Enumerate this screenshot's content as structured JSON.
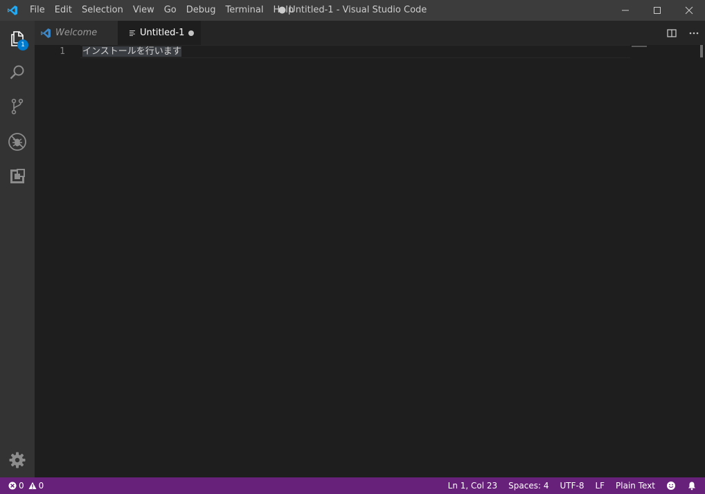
{
  "window": {
    "title": "● Untitled-1 - Visual Studio Code"
  },
  "menu": [
    "File",
    "Edit",
    "Selection",
    "View",
    "Go",
    "Debug",
    "Terminal",
    "Help"
  ],
  "activity_bar": {
    "items": [
      "explorer-icon",
      "search-icon",
      "source-control-icon",
      "debug-icon",
      "extensions-icon"
    ],
    "explorer_badge": "1",
    "manage": "gear-icon"
  },
  "tabs": [
    {
      "label": "Welcome",
      "active": false
    },
    {
      "label": "Untitled-1",
      "active": true,
      "dirty": true
    }
  ],
  "editor": {
    "lines": [
      {
        "number": "1",
        "text": "インストールを行います"
      }
    ]
  },
  "status_bar": {
    "errors": "0",
    "warnings": "0",
    "position": "Ln 1, Col 23",
    "indentation": "Spaces: 4",
    "encoding": "UTF-8",
    "eol": "LF",
    "language": "Plain Text"
  },
  "colors": {
    "accent": "#007acc",
    "status_bar": "#68217a",
    "title_bar": "#3c3c3c",
    "editor_bg": "#1e1e1e",
    "activity_bar": "#333333"
  }
}
